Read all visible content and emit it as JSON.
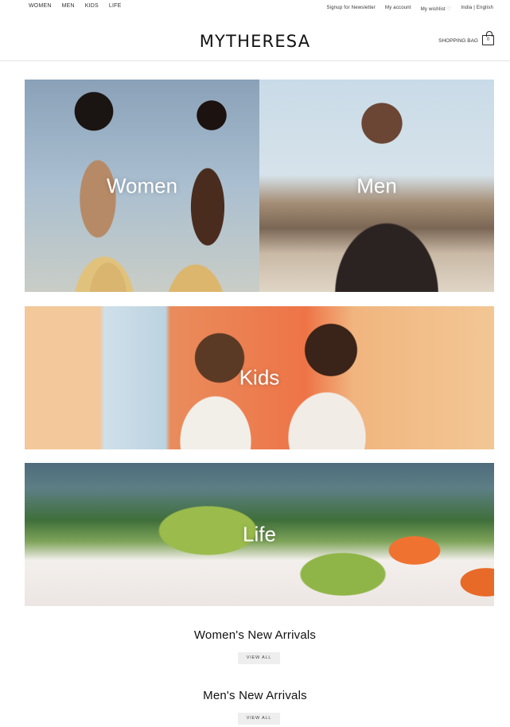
{
  "topnav": {
    "items": [
      "WOMEN",
      "MEN",
      "KIDS",
      "LIFE"
    ]
  },
  "utility": {
    "newsletter": "Signup for Newsletter",
    "account": "My account",
    "wishlist": "My wishlist",
    "locale": "India | English"
  },
  "header": {
    "logo": "MYTHERESA",
    "bag_label": "SHOPPING BAG",
    "bag_count": "0"
  },
  "tiles": {
    "women": "Women",
    "men": "Men",
    "kids": "Kids",
    "life": "Life"
  },
  "sections": [
    {
      "title": "Women's New Arrivals",
      "button": "VIEW ALL"
    },
    {
      "title": "Men's New Arrivals",
      "button": "VIEW ALL"
    }
  ],
  "icons": {
    "wishlist": "heart-icon",
    "bag": "shopping-bag-icon"
  }
}
